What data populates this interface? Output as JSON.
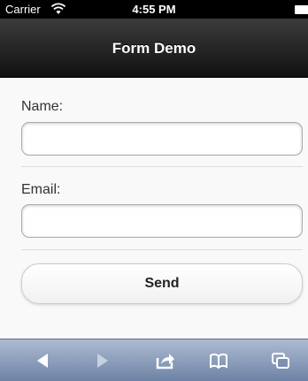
{
  "status_bar": {
    "carrier": "Carrier",
    "time": "4:55 PM"
  },
  "header": {
    "title": "Form Demo"
  },
  "form": {
    "name_label": "Name:",
    "name_value": "",
    "email_label": "Email:",
    "email_value": "",
    "send_label": "Send"
  },
  "toolbar": {
    "icons": [
      "back-icon",
      "forward-icon",
      "share-icon",
      "bookmarks-icon",
      "tabs-icon"
    ]
  },
  "colors": {
    "header_bg": "#1f1f1f",
    "toolbar_bg": "#8a9cb9",
    "content_bg": "#f9f9f9"
  }
}
